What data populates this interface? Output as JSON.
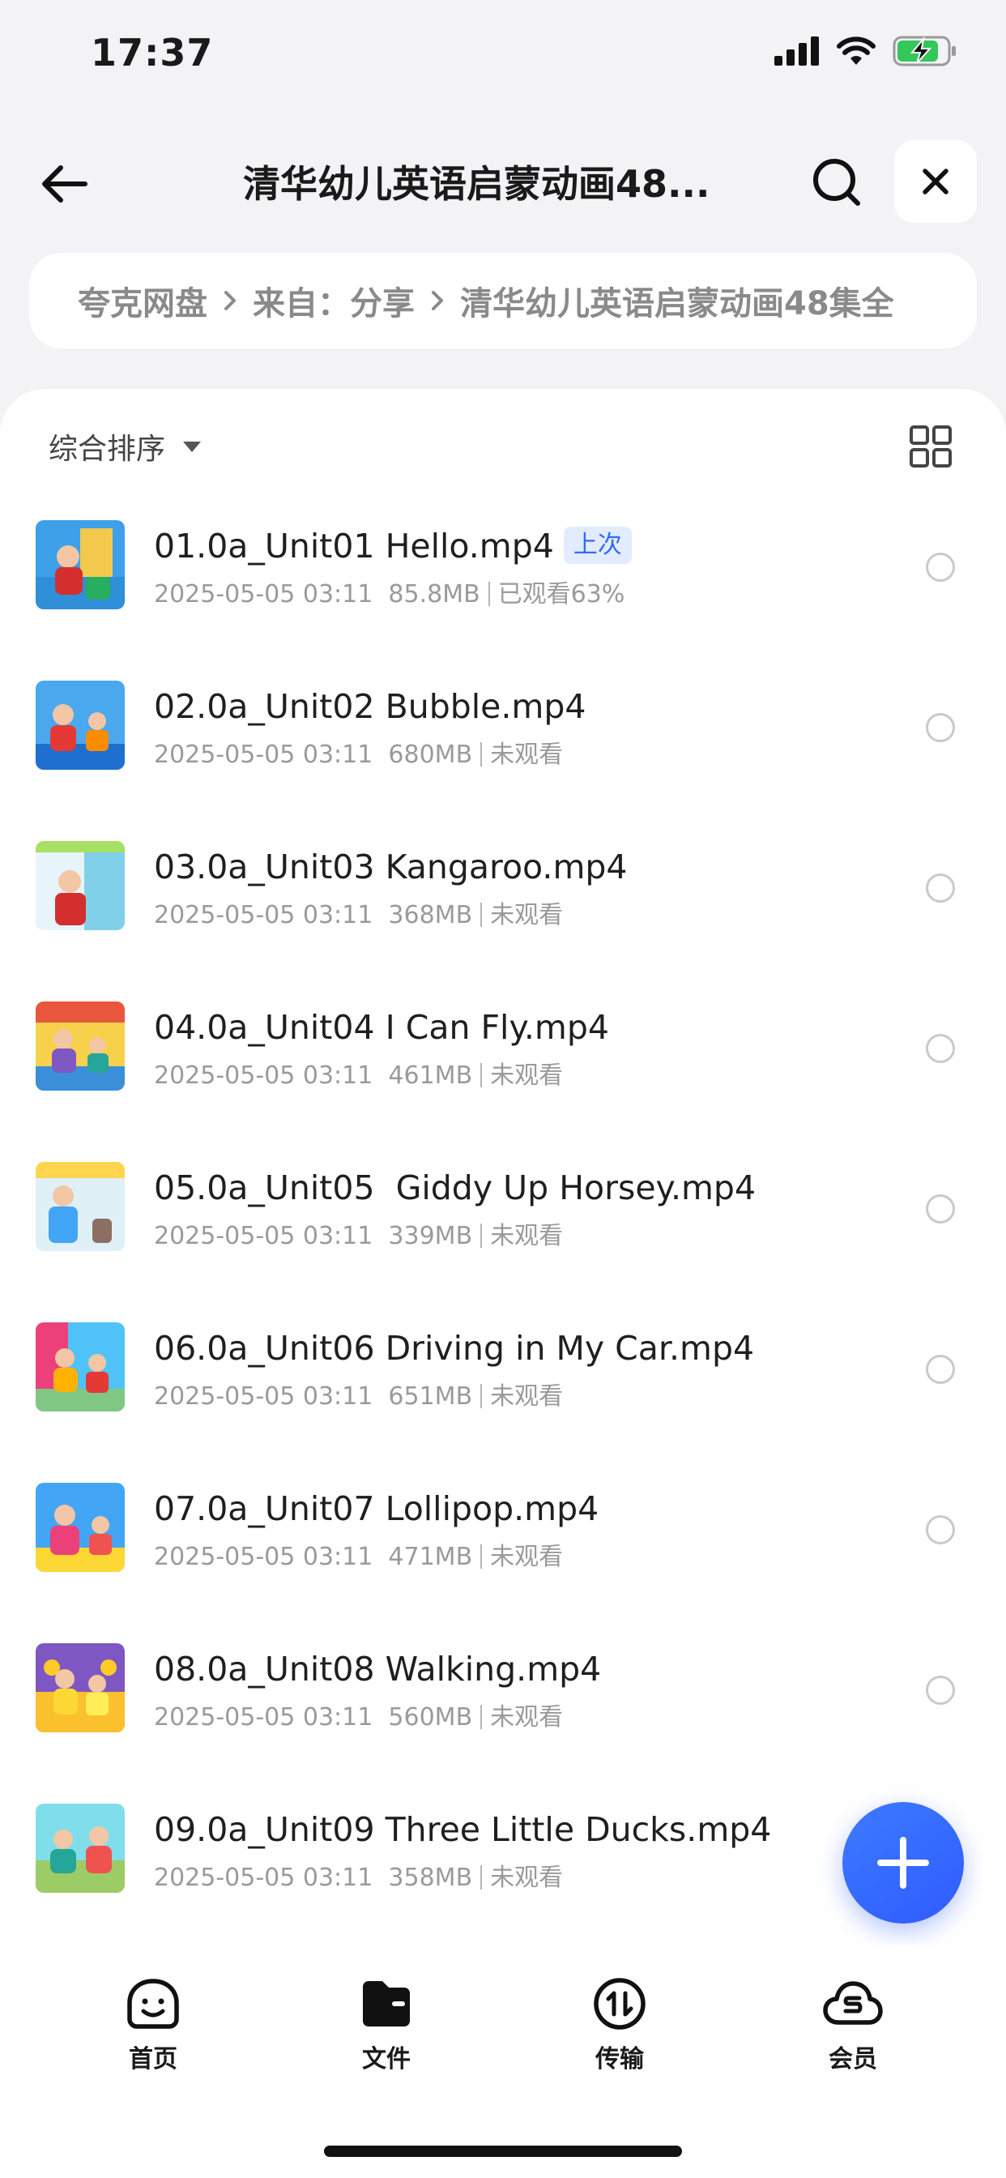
{
  "status_bar": {
    "time": "17:37"
  },
  "nav": {
    "title": "清华幼儿英语启蒙动画48..."
  },
  "breadcrumb": {
    "items": [
      "夸克网盘",
      "来自：分享",
      "清华幼儿英语启蒙动画48集全"
    ]
  },
  "sort": {
    "label": "综合排序"
  },
  "files": [
    {
      "name": "01.0a_Unit01 Hello.mp4",
      "badge": "上次",
      "date": "2025-05-05 03:11",
      "size": "85.8MB",
      "status": "已观看63%"
    },
    {
      "name": "02.0a_Unit02 Bubble.mp4",
      "date": "2025-05-05 03:11",
      "size": "680MB",
      "status": "未观看"
    },
    {
      "name": "03.0a_Unit03 Kangaroo.mp4",
      "date": "2025-05-05 03:11",
      "size": "368MB",
      "status": "未观看"
    },
    {
      "name": "04.0a_Unit04 I Can Fly.mp4",
      "date": "2025-05-05 03:11",
      "size": "461MB",
      "status": "未观看"
    },
    {
      "name": "05.0a_Unit05  Giddy Up Horsey.mp4",
      "date": "2025-05-05 03:11",
      "size": "339MB",
      "status": "未观看"
    },
    {
      "name": "06.0a_Unit06 Driving in My Car.mp4",
      "date": "2025-05-05 03:11",
      "size": "651MB",
      "status": "未观看"
    },
    {
      "name": "07.0a_Unit07 Lollipop.mp4",
      "date": "2025-05-05 03:11",
      "size": "471MB",
      "status": "未观看"
    },
    {
      "name": "08.0a_Unit08 Walking.mp4",
      "date": "2025-05-05 03:11",
      "size": "560MB",
      "status": "未观看"
    },
    {
      "name": "09.0a_Unit09 Three Little Ducks.mp4",
      "date": "2025-05-05 03:11",
      "size": "358MB",
      "status": "未观看"
    }
  ],
  "tabbar": {
    "items": [
      {
        "label": "首页",
        "icon": "smile-face-icon"
      },
      {
        "label": "文件",
        "icon": "folder-icon"
      },
      {
        "label": "传输",
        "icon": "transfer-icon"
      },
      {
        "label": "会员",
        "icon": "cloud-s-icon"
      }
    ]
  },
  "colors": {
    "accent": "#2f6bff",
    "badge_bg": "#e3ecff",
    "battery": "#34c759"
  }
}
